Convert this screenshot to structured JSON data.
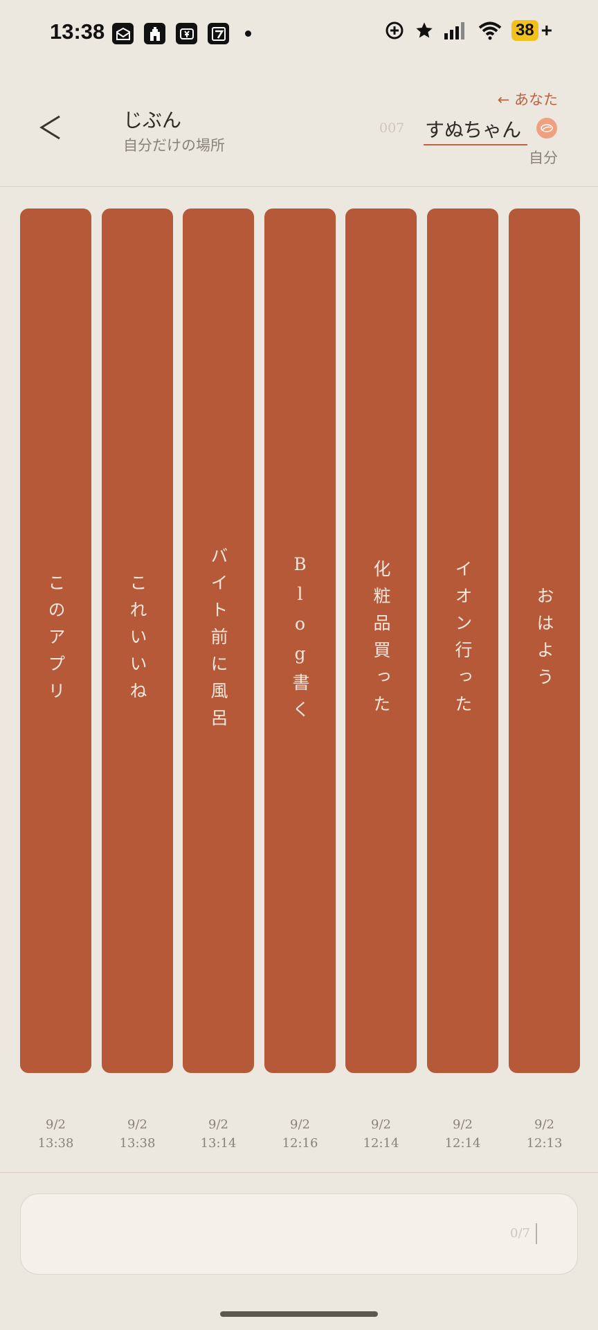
{
  "status_bar": {
    "time": "13:38",
    "notification_icons": [
      "mail-icon",
      "castle-icon",
      "yen-icon",
      "app-icon"
    ],
    "battery": "38",
    "battery_suffix": "+"
  },
  "header": {
    "title": "じぶん",
    "subtitle": "自分だけの場所",
    "you_link": "← あなた",
    "seq_number": "007",
    "name": "すぬちゃん",
    "self_label": "自分",
    "accent_color": "#c1603f"
  },
  "entries": [
    {
      "text": "このアプリ",
      "date": "9/2",
      "time": "13:38"
    },
    {
      "text": "これいいね",
      "date": "9/2",
      "time": "13:38"
    },
    {
      "text": "バイト前に風呂",
      "date": "9/2",
      "time": "13:14"
    },
    {
      "text": "Blog書く",
      "date": "9/2",
      "time": "12:16"
    },
    {
      "text": "化粧品買った",
      "date": "9/2",
      "time": "12:14"
    },
    {
      "text": "イオン行った",
      "date": "9/2",
      "time": "12:14"
    },
    {
      "text": "おはよう",
      "date": "9/2",
      "time": "12:13"
    }
  ],
  "column_color": "#b55939",
  "input": {
    "counter": "0/7"
  }
}
